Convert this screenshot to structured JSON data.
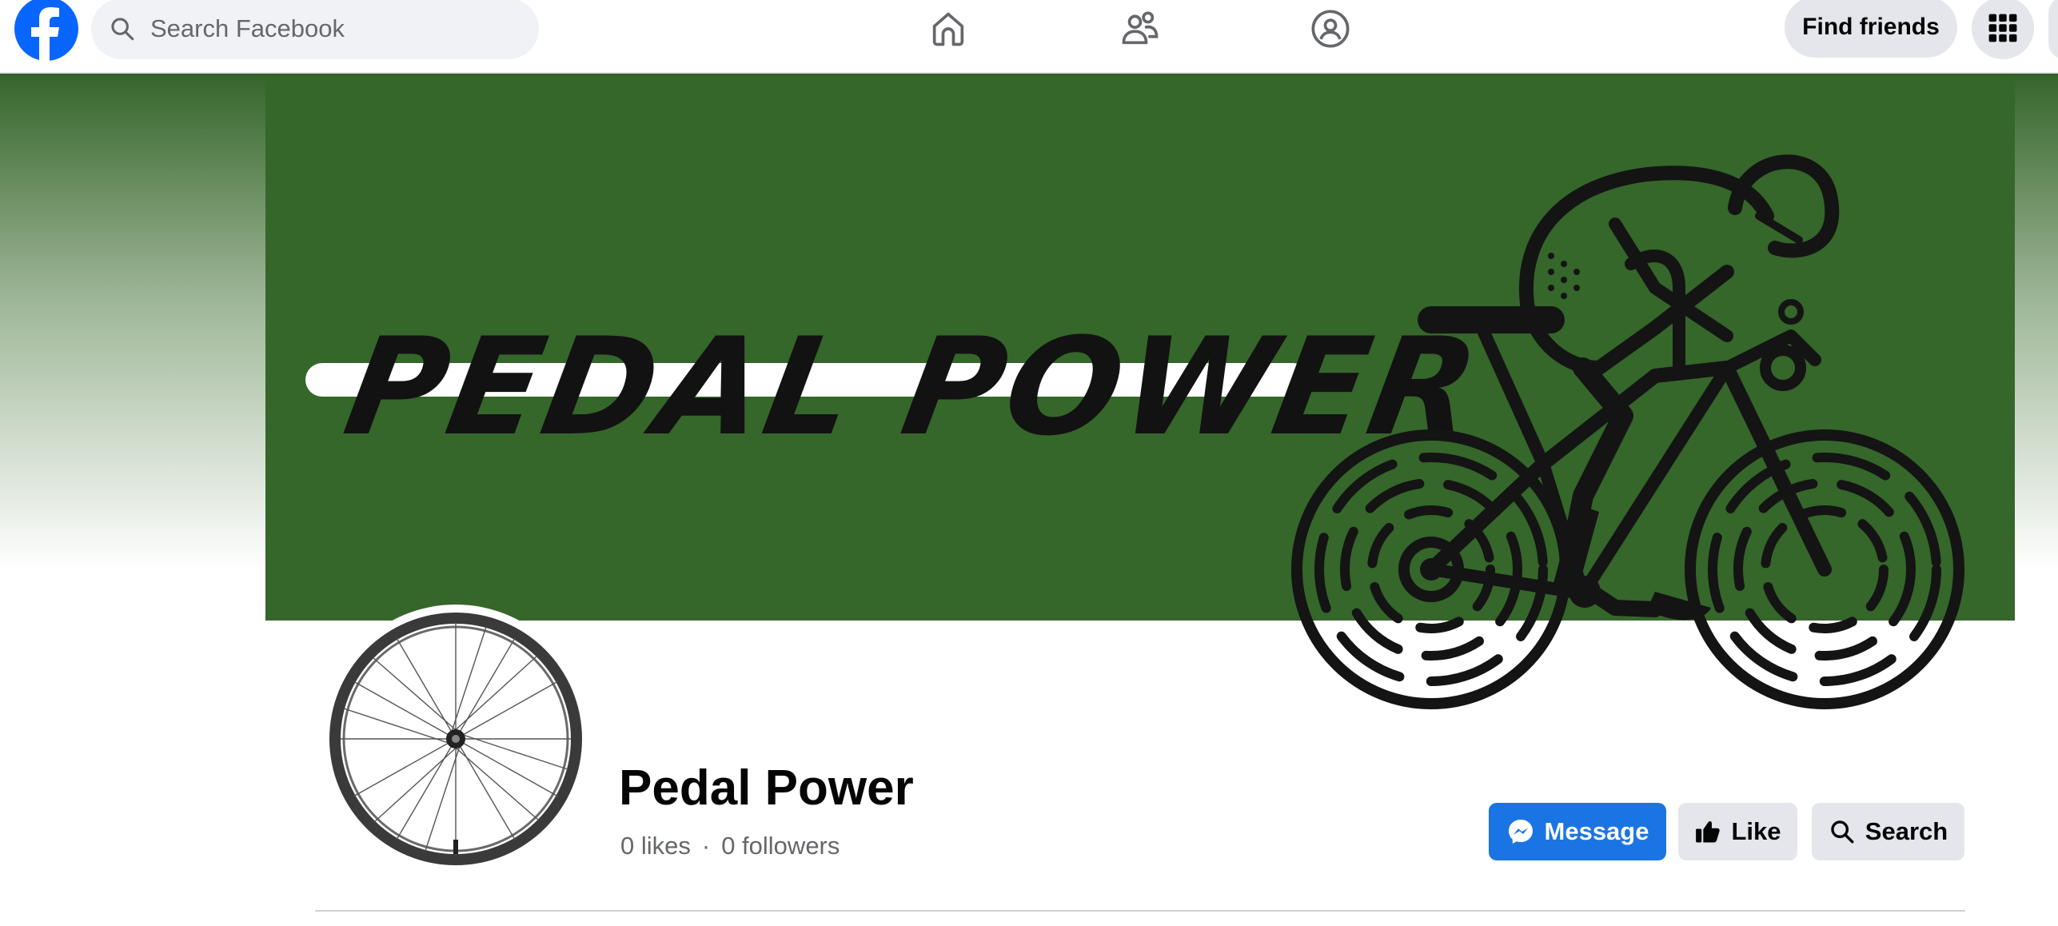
{
  "topbar": {
    "search_placeholder": "Search Facebook",
    "find_friends_label": "Find friends"
  },
  "icons": {
    "logo": "facebook-logo",
    "search": "search-icon",
    "home": "home-icon",
    "friends": "friends-icon",
    "groups": "groups-icon",
    "menu": "grid-menu-icon"
  },
  "cover": {
    "title": "PEDAL POWER"
  },
  "profile": {
    "name": "Pedal Power",
    "likes": "0 likes",
    "separator": "·",
    "followers": "0 followers"
  },
  "actions": {
    "message_label": "Message",
    "like_label": "Like",
    "search_label": "Search"
  },
  "colors": {
    "accent": "#1b74e4",
    "cover_green": "#35662a",
    "button_gray": "#e4e6eb"
  }
}
